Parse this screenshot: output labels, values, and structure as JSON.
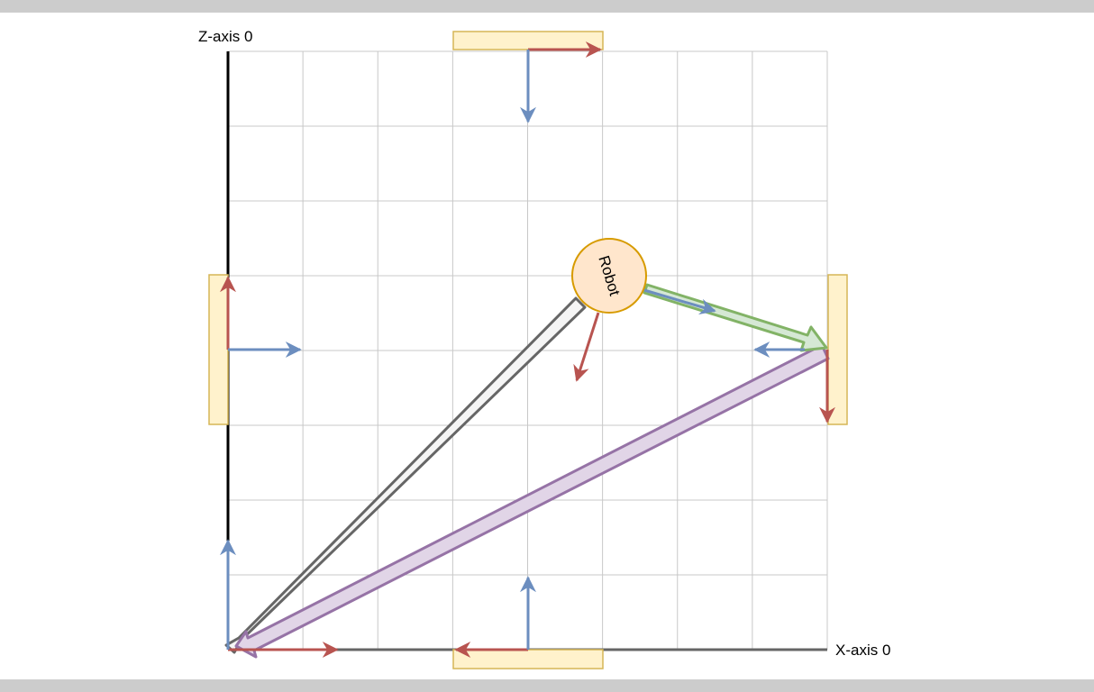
{
  "labels": {
    "z_axis": "Z-axis 0",
    "x_axis": "X-axis 0",
    "robot": "Robot"
  },
  "colors": {
    "background_frame": "#cccccc",
    "canvas": "#ffffff",
    "grid": "#c8c8c8",
    "z_axis_line": "#000000",
    "x_axis_line": "#666666",
    "marker_fill": "#fff2cc",
    "marker_stroke": "#d6b656",
    "red_arrow": "#b85450",
    "blue_arrow": "#6c8ebf",
    "robot_fill": "#ffe6cc",
    "robot_stroke": "#d79b00",
    "green_arrow_fill": "#d5e8d4",
    "green_arrow_stroke": "#82b366",
    "purple_arrow_fill": "#e1d5e7",
    "purple_arrow_stroke": "#9673a6",
    "gray_arrow_fill": "#f5f5f5",
    "gray_arrow_stroke": "#666666"
  },
  "grid": {
    "columns": 8,
    "rows": 8
  },
  "elements": [
    "marker-top",
    "marker-left",
    "marker-right",
    "marker-bottom",
    "robot",
    "robot-to-right-marker-arrow",
    "right-marker-to-origin-arrow",
    "robot-to-origin-arrow"
  ]
}
